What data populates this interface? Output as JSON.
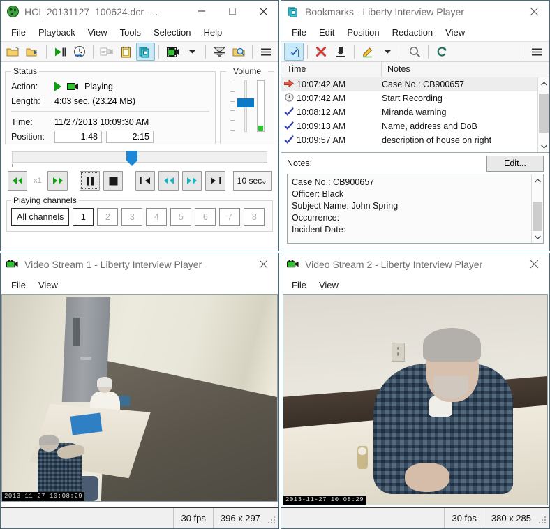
{
  "player": {
    "title": "HCI_20131127_100624.dcr -...",
    "title_icon": "film-reel-icon",
    "window_buttons": {
      "minimize": "—",
      "maximize": "☐",
      "close": "✕"
    },
    "menus": [
      "File",
      "Playback",
      "View",
      "Tools",
      "Selection",
      "Help"
    ],
    "toolbar": [
      {
        "name": "open-file-icon",
        "glyph": "📂"
      },
      {
        "name": "open-export-icon",
        "glyph": "📁"
      },
      {
        "name": "play-pause-icon",
        "glyph": "▶"
      },
      {
        "name": "goto-time-icon",
        "glyph": "🕓"
      },
      {
        "name": "camera-properties-icon",
        "glyph": "🎥"
      },
      {
        "name": "notes-icon",
        "glyph": "📒"
      },
      {
        "name": "bookmarks-icon",
        "glyph": "📑"
      },
      {
        "name": "video-export-icon",
        "glyph": "🎞"
      },
      {
        "name": "dropdown-arrow-icon",
        "glyph": "▼"
      },
      {
        "name": "audio-mixer-icon",
        "glyph": "☰"
      },
      {
        "name": "zoom-preview-icon",
        "glyph": "🔍"
      },
      {
        "name": "hamburger-menu-icon",
        "glyph": "☰"
      }
    ],
    "status": {
      "legend": "Status",
      "action_label": "Action:",
      "action_value": "Playing",
      "action_icon": "play-camera-icon",
      "length_label": "Length:",
      "length_value": "4:03 sec. (23.24 MB)",
      "time_label": "Time:",
      "time_value": "11/27/2013 10:09:30 AM",
      "position_label": "Position:",
      "position_elapsed": "1:48",
      "position_remaining": "-2:15"
    },
    "volume": {
      "legend": "Volume"
    },
    "transport": [
      {
        "name": "rewind-button",
        "glyph": "◀◀",
        "color": "#14a014"
      },
      {
        "name": "speed-indicator",
        "glyph": "x1"
      },
      {
        "name": "fast-forward-button",
        "glyph": "▶▶",
        "color": "#14a014"
      },
      {
        "name": "pause-button",
        "glyph": "❙❙",
        "color": "#1a1a1a"
      },
      {
        "name": "stop-button",
        "glyph": "■",
        "color": "#1a1a1a"
      },
      {
        "name": "skip-start-button",
        "glyph": "⏮",
        "color": "#1a1a1a"
      },
      {
        "name": "step-back-button",
        "glyph": "◀◀",
        "color": "#16b4c4"
      },
      {
        "name": "step-forward-button",
        "glyph": "▶▶",
        "color": "#16b4c4"
      },
      {
        "name": "skip-end-button",
        "glyph": "⏭",
        "color": "#1a1a1a"
      }
    ],
    "step_select": {
      "value": "10 sec",
      "chevron": "⌄"
    },
    "channels": {
      "legend": "Playing channels",
      "buttons": [
        {
          "label": "All channels",
          "enabled": true
        },
        {
          "label": "1",
          "enabled": true
        },
        {
          "label": "2",
          "enabled": false
        },
        {
          "label": "3",
          "enabled": false
        },
        {
          "label": "4",
          "enabled": false
        },
        {
          "label": "5",
          "enabled": false
        },
        {
          "label": "6",
          "enabled": false
        },
        {
          "label": "7",
          "enabled": false
        },
        {
          "label": "8",
          "enabled": false
        }
      ]
    }
  },
  "bookmarks": {
    "title": "Bookmarks - Liberty Interview Player",
    "title_icon": "bookmarks-icon",
    "close_glyph": "✕",
    "menus": [
      "File",
      "Edit",
      "Position",
      "Redaction",
      "View"
    ],
    "toolbar": [
      {
        "name": "new-bookmark-icon",
        "glyph": "📄"
      },
      {
        "name": "delete-bookmark-icon",
        "glyph": "✖"
      },
      {
        "name": "import-bookmark-icon",
        "glyph": "⬇"
      },
      {
        "name": "edit-pencil-icon",
        "glyph": "✎"
      },
      {
        "name": "dropdown-arrow-icon",
        "glyph": "▼"
      },
      {
        "name": "search-icon",
        "glyph": "🔍"
      },
      {
        "name": "refresh-icon",
        "glyph": "↻"
      },
      {
        "name": "hamburger-menu-icon",
        "glyph": "☰"
      }
    ],
    "columns": [
      "Time",
      "Notes"
    ],
    "rows": [
      {
        "icon": "red-arrow-icon",
        "glyph": "➡",
        "time": "10:07:42 AM",
        "note": "Case No.: CB900657",
        "selected": true
      },
      {
        "icon": "clock-icon",
        "glyph": "◴",
        "time": "10:07:42 AM",
        "note": "Start Recording",
        "selected": false
      },
      {
        "icon": "check-icon",
        "glyph": "✓",
        "time": "10:08:12 AM",
        "note": "Miranda warning",
        "selected": false
      },
      {
        "icon": "check-icon",
        "glyph": "✓",
        "time": "10:09:13 AM",
        "note": "Name, address and DoB",
        "selected": false
      },
      {
        "icon": "check-icon",
        "glyph": "✓",
        "time": "10:09:57 AM",
        "note": "description of house on right",
        "selected": false
      }
    ],
    "notes_label": "Notes:",
    "edit_button": "Edit...",
    "notes_lines": [
      "Case No.: CB900657",
      "Officer: Black",
      "Subject Name: John Spring",
      "Occurrence:",
      "Incident Date:"
    ]
  },
  "video1": {
    "title": "Video Stream 1 - Liberty Interview Player",
    "title_icon": "camcorder-icon",
    "close_glyph": "✕",
    "menus": [
      "File",
      "View"
    ],
    "timestamp": "2013-11-27 10:08:29",
    "fps": "30 fps",
    "resolution": "396 x 297"
  },
  "video2": {
    "title": "Video Stream 2 - Liberty Interview Player",
    "title_icon": "camcorder-icon",
    "close_glyph": "✕",
    "menus": [
      "File",
      "View"
    ],
    "timestamp": "2013-11-27 10:08:29",
    "fps": "30 fps",
    "resolution": "380 x 285"
  },
  "colors": {
    "accent": "#0a7ac6",
    "window_border": "#4a6b7c",
    "toolbar_active": "#cbe8f7",
    "green": "#11a011",
    "teal": "#16b4c4",
    "red": "#d63a2f"
  }
}
